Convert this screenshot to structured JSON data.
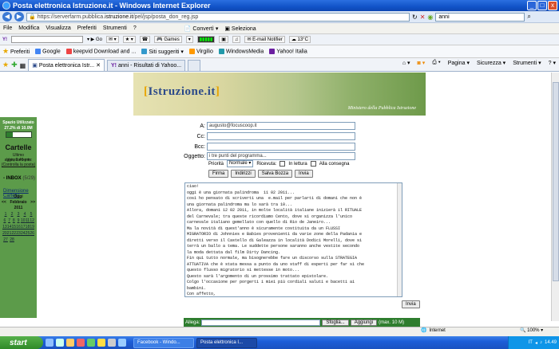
{
  "window": {
    "title": "Posta elettronica Istruzione.it - Windows Internet Explorer",
    "buttons": [
      "_",
      "□",
      "x"
    ]
  },
  "address": {
    "prefix": "https://",
    "host": "serverfarm.pubblica.",
    "domain": "istruzione.it",
    "path": "/pel/jsp/posta_don_reg.jsp",
    "search_value": "anni"
  },
  "menu": [
    "File",
    "Modifica",
    "Visualizza",
    "Preferiti",
    "Strumenti",
    "?"
  ],
  "toolbar": {
    "go_label": "Go",
    "convert_label": "Convertì",
    "select_label": "Seleziona",
    "games_label": "Games",
    "email_notifier": "E-mail Notifier",
    "temp": "13°C"
  },
  "favorites": {
    "label": "Preferiti",
    "items": [
      "Google",
      "keepvid Download and ...",
      "Siti suggeriti",
      "Virgilio",
      "WindowsMedia",
      "Yahoo! Italia"
    ]
  },
  "tabs": [
    {
      "label": "Posta elettronica Istr..."
    },
    {
      "label": "anni - Risultati di Yahoo..."
    }
  ],
  "tab_tools": [
    "Pagina",
    "Sicurezza",
    "Strumenti",
    "?"
  ],
  "banner": {
    "logo_open": "[",
    "logo_text": "Istruzione.it",
    "logo_close": "]",
    "subtitle": "Ministero della Pubblica Istruzione"
  },
  "sidebar": {
    "space_label": "Spazio Utilizzato",
    "space_value": "27.2% di 10.0M",
    "usage_fraction": 0.272,
    "title": "Cartelle",
    "updated_label": "Ultimo aggiornamento:",
    "updated_time": "Ven, 2:40 pm",
    "check_link": "(Controlla la posta)",
    "inbox_label": "INBOX",
    "inbox_count": "(5/29)",
    "folders_link": "Dimensione Cartelle",
    "calendar": {
      "today": "Oggi",
      "prev": "<<",
      "month": "Febbraio 2011",
      "next": ">>",
      "weeks": [
        [
          "1",
          "2",
          "3",
          "4",
          "5"
        ],
        [
          "6",
          "7",
          "8",
          "9",
          "10",
          "11",
          "12"
        ],
        [
          "13",
          "14",
          "15",
          "16",
          "17",
          "18",
          "19"
        ],
        [
          "20",
          "21",
          "22",
          "23",
          "24",
          "25",
          "26"
        ],
        [
          "27",
          "28"
        ]
      ]
    }
  },
  "compose": {
    "to_label": "A:",
    "to_value": "augusto@focuscoop.it",
    "cc_label": "Cc:",
    "cc_value": "",
    "bcc_label": "Bcc:",
    "bcc_value": "",
    "subject_label": "Oggetto:",
    "subject_value": "i tre punti del programma...",
    "priority_label": "Priorità",
    "priority_value": "Normale",
    "receipt_label": "Ricevuta:",
    "read_label": "In lettura",
    "delivery_label": "Alla consegna",
    "btn_sign": "Firma",
    "btn_addresses": "Indirizzi",
    "btn_draft": "Salva Bozza",
    "btn_send": "Invia",
    "body": "ciao!\noggi è una giornata palindroma  11 02 2011...\ncosì ho pensato di scriverti una  e.mail per parlarti di domani che non è\nuna giornata palindroma ma lo sarà tra 10...\nAllora, domani 12 02 2011, in molte località italiane inizierà il RITUALE\ndel Carnevale; tra queste ricordiamo Cento, dove si organizza l'unico\ncarnevale italiano gemellato con quello di Rio de Janeiro...\nMa la novità di quest'anno è sicuramente costituita da un FLUSSI\nMIGRATORIO di Johnnies e Babies provenienti da varie zone della Padania e\ndiretti verso il Castello di Galeazza in località Dodici Morelli, dove si\nterrà un ballo a tema. Le suddette persone saranno anche vestite secondo\nla moda dettata dal film Dirty Dancing.\nFin qui tutto normale, ma bisognerebbe fare un discorso sulla STRATEGIA\nATTUATIVA che è stata messa a punto da uno staff di esperti per far sì che\nquesto flusso migratorio si mettesse in moto...\nQuesto sarà l'argomento di un prossimo trattato epistolare.\nColgo l'occasione per porgerti i miei più cordiali saluti e bacetti ai\nbambini.\nCon affetto,\nSARACENA",
    "btn_send_bottom": "Invia"
  },
  "attach": {
    "label": "Allega:",
    "browse": "Sfoglia...",
    "add": "Aggiungi",
    "max": "(max. 10 M)"
  },
  "status": {
    "zone": "Internet",
    "zoom": "100%"
  },
  "taskbar": {
    "start": "start",
    "tasks": [
      "Facebook - Windo...",
      "Posta elettronica I..."
    ],
    "lang": "IT",
    "time": "14.49"
  },
  "colors": {
    "sidebar_green": "#5c9b4a",
    "attach_green": "#2e7d2e",
    "xp_blue": "#1153c8"
  }
}
